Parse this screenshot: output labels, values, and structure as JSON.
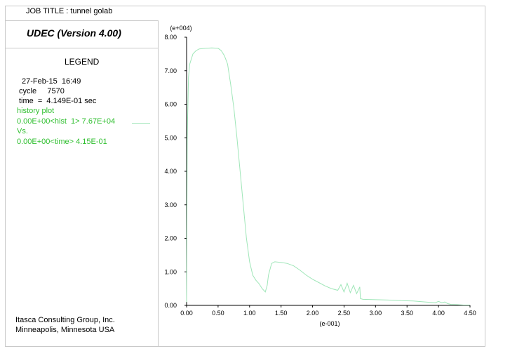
{
  "header": {
    "job_title": "JOB TITLE :  tunnel golab"
  },
  "panel": {
    "version": "UDEC (Version 4.00)",
    "legend_title": "LEGEND",
    "date": "27-Feb-15  16:49",
    "cycle": "cycle     7570",
    "time": "time  =  4.149E-01 sec",
    "history_label": "history plot",
    "hist_range": "0.00E+00<hist  1> 7.67E+04",
    "vs_label": "Vs.",
    "time_range": "0.00E+00<time> 4.15E-01",
    "company": "Itasca Consulting Group, Inc.",
    "location": "Minneapolis, Minnesota  USA",
    "series_color": "#9fe6b8",
    "legend_text_color": "#2fbf2f"
  },
  "chart_data": {
    "type": "line",
    "title": "",
    "xlabel": "(e-001)",
    "ylabel": "(e+004)",
    "xlim": [
      0,
      4.5
    ],
    "ylim": [
      0,
      8
    ],
    "xticks": [
      "0.00",
      "0.50",
      "1.00",
      "1.50",
      "2.00",
      "2.50",
      "3.00",
      "3.50",
      "4.00",
      "4.50"
    ],
    "yticks": [
      "0.00",
      "1.00",
      "2.00",
      "3.00",
      "4.00",
      "5.00",
      "6.00",
      "7.00",
      "8.00"
    ],
    "grid": false,
    "series": [
      {
        "x": [
          0.0,
          0.01,
          0.03,
          0.05,
          0.1,
          0.15,
          0.2,
          0.3,
          0.4,
          0.5,
          0.55,
          0.6,
          0.65,
          0.7,
          0.75,
          0.8,
          0.85,
          0.9,
          0.95,
          1.0,
          1.05,
          1.1,
          1.15,
          1.2,
          1.25,
          1.28,
          1.3,
          1.35,
          1.4,
          1.5,
          1.6,
          1.7,
          1.8,
          1.9,
          2.0,
          2.1,
          2.2,
          2.3,
          2.4,
          2.45,
          2.5,
          2.55,
          2.6,
          2.65,
          2.7,
          2.75,
          2.76,
          2.8,
          3.0,
          3.2,
          3.4,
          3.6,
          3.8,
          3.95,
          4.0,
          4.05,
          4.1,
          4.15,
          4.2,
          4.3,
          4.4,
          4.5
        ],
        "y": [
          0.1,
          5.0,
          6.8,
          7.2,
          7.5,
          7.6,
          7.65,
          7.67,
          7.68,
          7.67,
          7.6,
          7.45,
          7.2,
          6.6,
          5.9,
          5.0,
          4.0,
          3.0,
          2.0,
          1.3,
          0.9,
          0.75,
          0.65,
          0.5,
          0.4,
          0.6,
          0.9,
          1.25,
          1.3,
          1.28,
          1.25,
          1.18,
          1.05,
          0.9,
          0.78,
          0.68,
          0.58,
          0.5,
          0.45,
          0.62,
          0.4,
          0.66,
          0.38,
          0.6,
          0.35,
          0.55,
          0.2,
          0.18,
          0.17,
          0.16,
          0.14,
          0.13,
          0.1,
          0.08,
          0.12,
          0.08,
          0.1,
          0.05,
          0.03,
          0.02,
          0.01,
          0.01
        ]
      }
    ]
  }
}
